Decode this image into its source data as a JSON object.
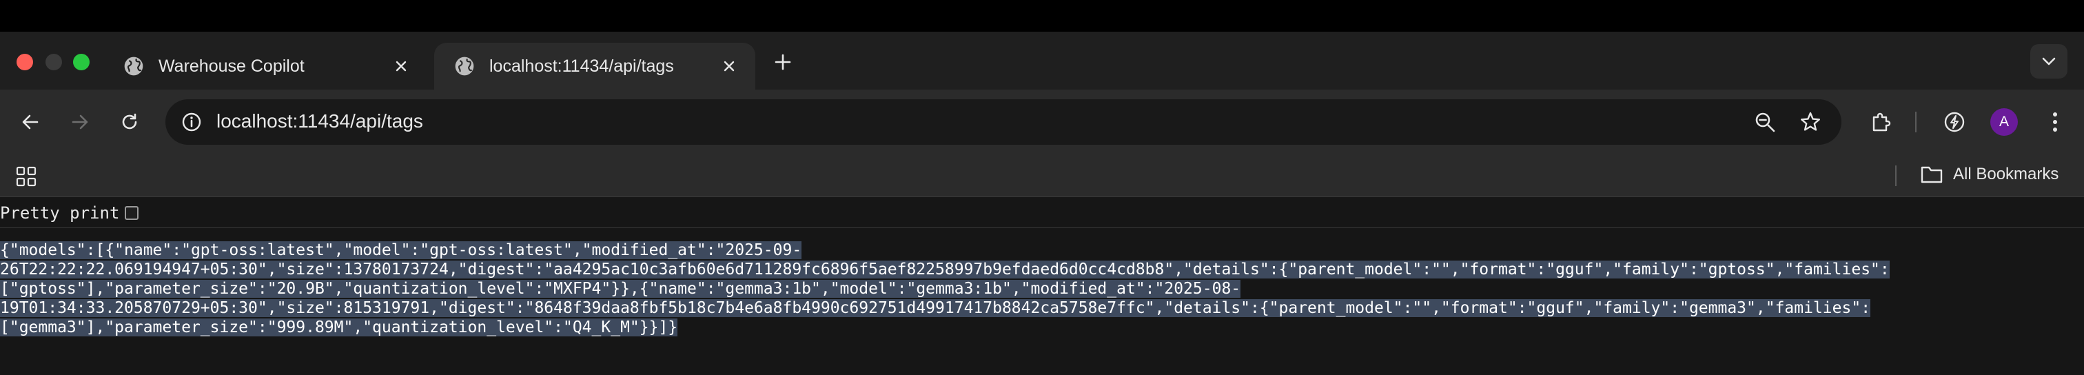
{
  "window": {
    "controls": [
      "close",
      "minimize",
      "zoom"
    ]
  },
  "tabs": [
    {
      "title": "Warehouse Copilot",
      "icon": "globe-icon",
      "active": false
    },
    {
      "title": "localhost:11434/api/tags",
      "icon": "globe-icon",
      "active": true
    }
  ],
  "toolbar": {
    "url": "localhost:11434/api/tags",
    "avatar_letter": "A",
    "colors": {
      "avatar": "#6a1b9a"
    }
  },
  "bookmarks": {
    "all_bookmarks_label": "All Bookmarks"
  },
  "page": {
    "pretty_print_label": "Pretty print",
    "pretty_print_checked": false,
    "json_lines": [
      "{\"models\":[{\"name\":\"gpt-oss:latest\",\"model\":\"gpt-oss:latest\",\"modified_at\":\"2025-09-",
      "26T22:22:22.069194947+05:30\",\"size\":13780173724,\"digest\":\"aa4295ac10c3afb60e6d711289fc6896f5aef82258997b9efdaed6d0cc4cd8b8\",\"details\":{\"parent_model\":\"\",\"format\":\"gguf\",\"family\":\"gptoss\",\"families\":",
      "[\"gptoss\"],\"parameter_size\":\"20.9B\",\"quantization_level\":\"MXFP4\"}},{\"name\":\"gemma3:1b\",\"model\":\"gemma3:1b\",\"modified_at\":\"2025-08-",
      "19T01:34:33.205870729+05:30\",\"size\":815319791,\"digest\":\"8648f39daa8fbf5b18c7b4e6a8fb4990c692751d49917417b8842ca5758e7ffc\",\"details\":{\"parent_model\":\"\",\"format\":\"gguf\",\"family\":\"gemma3\",\"families\":",
      "[\"gemma3\"],\"parameter_size\":\"999.89M\",\"quantization_level\":\"Q4_K_M\"}}]}"
    ]
  }
}
